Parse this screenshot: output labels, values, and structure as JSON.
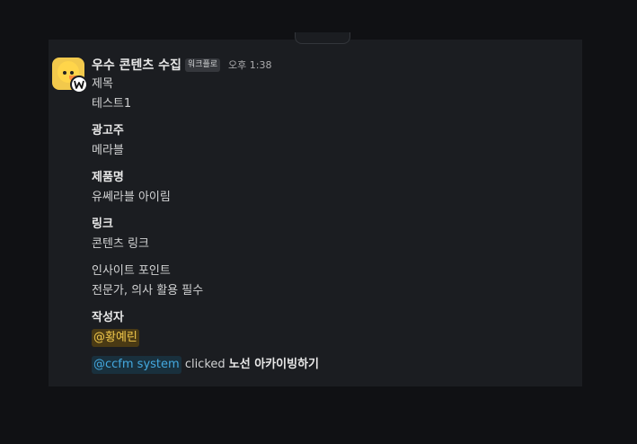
{
  "message": {
    "sender": "우수 콘텐츠 수집",
    "app_tag": "워크플로",
    "time": "오후 1:38"
  },
  "fields": [
    {
      "label": "제목",
      "value": "테스트1",
      "label_bold": false
    },
    {
      "label": "광고주",
      "value": "메라블",
      "label_bold": true
    },
    {
      "label": "제품명",
      "value": "유쎄라블 아이림",
      "label_bold": true
    },
    {
      "label": "링크",
      "value": "콘텐츠 링크",
      "label_bold": true
    },
    {
      "label": "인사이트 포인트",
      "value": "전문가, 의사 활용 필수",
      "label_bold": false
    }
  ],
  "author": {
    "label": "작성자",
    "mention": "@황예린"
  },
  "action": {
    "user": "@ccfm system",
    "verb": "clicked",
    "button": "노선 아카이빙하기"
  },
  "colors": {
    "background": "#101114",
    "panel": "#1b1d21",
    "mention_bg": "#4a3a14",
    "mention_text": "#f2c94c",
    "user_mention_bg": "#19303d",
    "user_mention_text": "#44a9e0"
  }
}
